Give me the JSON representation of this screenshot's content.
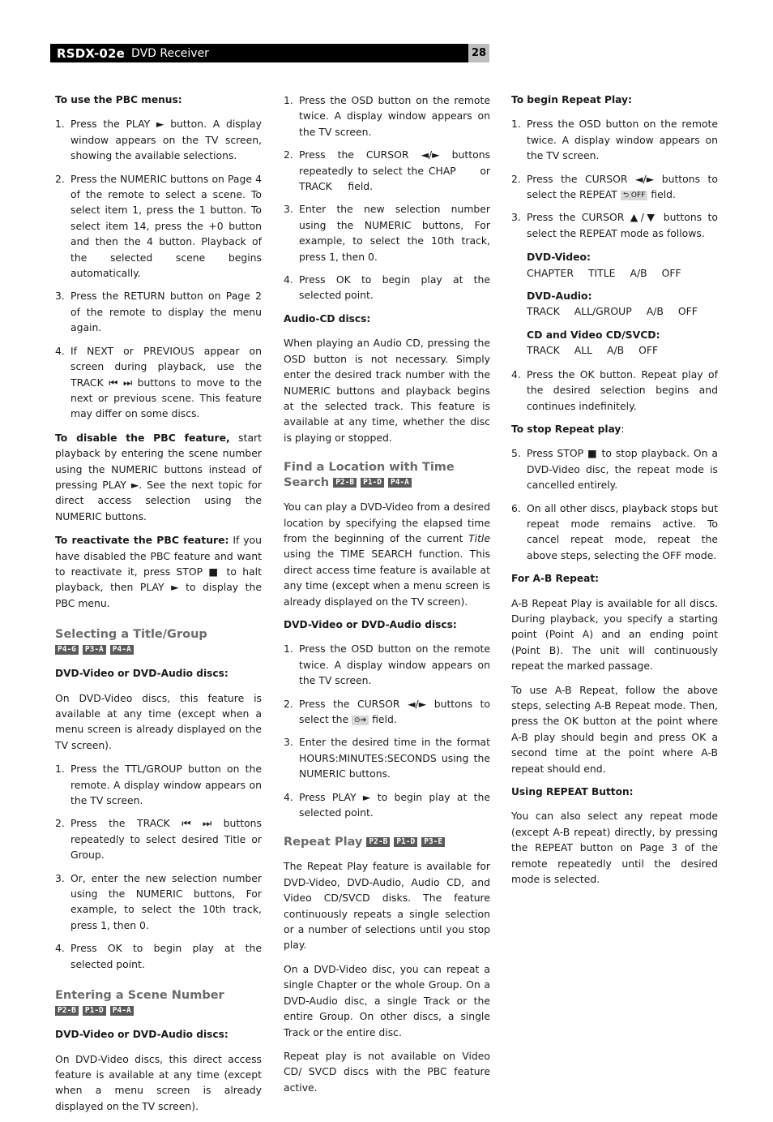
{
  "header": {
    "model": "RSDX-02e",
    "description": "DVD Receiver",
    "page_number": "28"
  },
  "icons": {
    "play": "►",
    "stop": "■",
    "prev": "⏮",
    "next": "⏭",
    "left": "◄",
    "right": "►",
    "up": "▲",
    "down": "▼",
    "repeat": "⮌",
    "time": "⊙➔"
  },
  "col1": {
    "pbc_label": "To use the PBC menus:",
    "pbc_steps": [
      "Press the PLAY ► button. A display window appears on the TV screen, showing the available selections.",
      "Press the NUMERIC buttons on Page 4 of the remote to select a scene. To select item 1, press the 1 button. To select item 14, press the +0 button and then the 4 button. Playback of the selected scene begins automatically.",
      "Press the RETURN button on Page 2 of the remote to display the menu again.",
      "If NEXT or PREVIOUS appear on screen during playback, use the TRACK ⏮ ⏭ buttons to move to the next or previous scene. This feature may differ on some discs."
    ],
    "disable_lead": "To disable the PBC feature,",
    "disable_text": " start playback by entering the scene number using the NUMERIC buttons instead of pressing PLAY ►. See the next topic for direct access selection using the NUMERIC buttons.",
    "reactivate_lead": "To reactivate the PBC feature:",
    "reactivate_text": " If you have disabled the PBC feature and want to reactivate it, press STOP ■ to halt playback, then PLAY ► to display the PBC menu.",
    "title_heading": "Selecting a Title/Group",
    "title_tags": [
      "P4-G",
      "P3-A",
      "P4-A"
    ],
    "title_disc_label": "DVD-Video or DVD-Audio discs:",
    "title_intro": "On DVD-Video discs, this feature is available at any time (except when a menu screen is already displayed on the TV screen).",
    "title_steps": [
      "Press the TTL/GROUP button on the remote. A display window appears on the TV screen.",
      "Press the TRACK ⏮ ⏭ buttons repeatedly to select desired Title or Group.",
      "Or, enter the new selection number using the NUMERIC buttons, For example, to select the 10th track, press 1, then 0.",
      "Press OK to begin play at the selected point."
    ],
    "scene_heading": "Entering a Scene Number",
    "scene_tags": [
      "P2-B",
      "P1-D",
      "P4-A"
    ],
    "scene_disc_label": "DVD-Video or DVD-Audio discs:",
    "scene_intro": "On DVD-Video discs, this direct access feature is available at any time (except when a menu screen is already displayed on the TV screen)."
  },
  "col2": {
    "steps": [
      "Press the OSD button on the remote twice. A display window appears on the TV screen.",
      "Press the CURSOR ◄/► buttons repeatedly to select the CHAP     or TRACK     field.",
      "Enter the new selection number using the NUMERIC buttons, For example, to select the 10th track, press 1, then 0.",
      "Press OK to begin play at the selected point."
    ],
    "audiocd_label": "Audio-CD discs:",
    "audiocd_text": "When playing an Audio CD, pressing the OSD button is not necessary. Simply enter the desired track number with the NUMERIC buttons and playback begins at the selected track. This feature is available at any time, whether the disc is playing or stopped.",
    "time_heading": "Find a Location with Time Search",
    "time_tags": [
      "P2-B",
      "P1-D",
      "P4-A"
    ],
    "time_intro_a": "You can play a DVD-Video from a desired location by specifying the elapsed time from the beginning of the current ",
    "time_intro_em": "Title",
    "time_intro_b": " using the TIME SEARCH function. This direct access time feature is available at any time (except when a menu screen is already displayed on the TV screen).",
    "time_disc_label": "DVD-Video or DVD-Audio discs:",
    "time_steps": [
      "Press the OSD button on the remote twice. A display window appears on the TV screen.",
      "Press the CURSOR ◄/► buttons to select the",
      "Enter the desired time in the format HOURS:MINUTES:SECONDS using the NUMERIC buttons.",
      "Press PLAY ► to begin play at the selected point."
    ],
    "time_step2_tail": " field.",
    "repeat_heading": "Repeat Play",
    "repeat_tags": [
      "P2-B",
      "P1-D",
      "P3-E"
    ],
    "repeat_p1": "The Repeat Play feature is available for DVD-Video, DVD-Audio, Audio CD, and Video CD/SVCD disks. The feature continuously repeats a single selection or a number of selections until you stop play.",
    "repeat_p2": "On a DVD-Video disc, you can repeat a single Chapter or the whole Group. On a DVD-Audio disc, a single Track or the entire Group. On other discs, a single Track or the entire disc.",
    "repeat_p3": "Repeat play is not available on Video CD/ SVCD discs with the PBC feature active."
  },
  "col3": {
    "begin_label": "To begin Repeat Play:",
    "begin_steps": [
      "Press the OSD button on the remote twice. A display window appears on the TV screen.",
      "Press the CURSOR ◄/► buttons to select the REPEAT",
      "Press the CURSOR ▲/▼ buttons to select the REPEAT mode as follows."
    ],
    "repeat_field_osd": "⮌ OFF",
    "repeat_field_tail": " field.",
    "modes": [
      {
        "label": "DVD-Video:",
        "values": [
          "CHAPTER",
          "TITLE",
          "A/B",
          "OFF"
        ]
      },
      {
        "label": "DVD-Audio:",
        "values": [
          "TRACK",
          "ALL/GROUP",
          "A/B",
          "OFF"
        ]
      },
      {
        "label": "CD and Video CD/SVCD:",
        "values": [
          "TRACK",
          "ALL",
          "A/B",
          "OFF"
        ]
      }
    ],
    "step4": "Press the OK button. Repeat play of the desired selection begins and continues indefinitely.",
    "stop_label": "To stop Repeat play",
    "stop_steps": [
      "Press STOP ■ to stop playback. On a DVD-Video disc, the repeat mode is cancelled entirely.",
      "On all other discs, playback stops but repeat mode remains active. To cancel repeat mode, repeat the above steps, selecting the OFF mode."
    ],
    "ab_label": "For A-B Repeat:",
    "ab_p1": "A-B Repeat Play is available for all discs. During playback, you specify a starting point (Point A) and an ending point (Point B). The unit will continuously repeat the marked passage.",
    "ab_p2": "To use A-B Repeat, follow the above steps, selecting A-B Repeat mode. Then, press the OK button at the point where A-B play should begin and press OK a second time at the point where A-B repeat should end.",
    "button_label": "Using REPEAT Button:",
    "button_text": "You can also select any repeat mode (except A-B repeat) directly, by pressing the REPEAT button on Page 3 of the remote repeatedly until the desired mode is selected."
  }
}
